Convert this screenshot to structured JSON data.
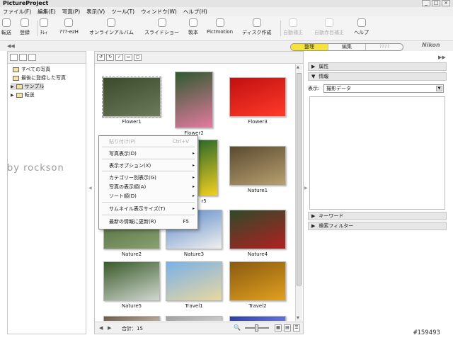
{
  "window": {
    "title": "PictureProject",
    "min_glyph": "_",
    "max_glyph": "□",
    "close_glyph": "×"
  },
  "menu": [
    "ファイル(F)",
    "編集(E)",
    "写真(P)",
    "表示(V)",
    "ツール(T)",
    "ウィンドウ(W)",
    "ヘルプ(H)"
  ],
  "toolbar": [
    {
      "label": "転送",
      "icon": "transfer-icon",
      "enabled": true
    },
    {
      "label": "登録",
      "icon": "register-icon",
      "enabled": true
    },
    {
      "label": "ﾁﾚｨ",
      "icon": "rotate-icon",
      "enabled": true
    },
    {
      "label": "???-ezH",
      "icon": "email-icon",
      "enabled": true
    },
    {
      "label": "オンラインアルバム",
      "icon": "online-album-icon",
      "enabled": true
    },
    {
      "label": "スライドショー",
      "icon": "slideshow-icon",
      "enabled": true
    },
    {
      "label": "製本",
      "icon": "book-icon",
      "enabled": true
    },
    {
      "label": "Pictmotion",
      "icon": "pictmotion-icon",
      "enabled": true
    },
    {
      "label": "ディスク作成",
      "icon": "disc-icon",
      "enabled": true
    },
    {
      "label": "自動補正",
      "icon": "auto-correct-icon",
      "enabled": false
    },
    {
      "label": "自動赤目補正",
      "icon": "red-eye-icon",
      "enabled": false
    },
    {
      "label": "ヘルプ",
      "icon": "help-icon",
      "enabled": true
    }
  ],
  "mode_tabs": [
    "整理",
    "編集",
    "????"
  ],
  "active_mode": "整理",
  "brand": "Nikon",
  "collapse_glyph": "◀◀",
  "expand_glyph": "▶▶",
  "left_tree": [
    {
      "label": "すべての写真",
      "selected": false,
      "arrow": ""
    },
    {
      "label": "最後に登録した写真",
      "selected": false,
      "arrow": ""
    },
    {
      "label": "サンプル",
      "selected": true,
      "arrow": "▶"
    },
    {
      "label": "転送",
      "selected": false,
      "arrow": "▶"
    }
  ],
  "thumbnails": [
    {
      "label": "Flower1",
      "colors": [
        "#3b4a2a",
        "#6b7a5a"
      ],
      "selected": true
    },
    {
      "label": "Flower2",
      "colors": [
        "#2f5a2f",
        "#e47aa0"
      ],
      "selected": false
    },
    {
      "label": "Flower3",
      "colors": [
        "#c01010",
        "#ff3a2a"
      ],
      "selected": false
    },
    {
      "label": "r5",
      "colors": [
        "#2f6a2a",
        "#f2d020"
      ],
      "selected": false
    },
    {
      "label": "Nature1",
      "colors": [
        "#5a4a30",
        "#b8a070"
      ],
      "selected": false
    },
    {
      "label": "Nature2",
      "colors": [
        "#4a6a3a",
        "#8aa070"
      ],
      "selected": false
    },
    {
      "label": "Nature3",
      "colors": [
        "#5a88c8",
        "#f0f0f0"
      ],
      "selected": false
    },
    {
      "label": "Nature4",
      "colors": [
        "#2f4a2a",
        "#b02020"
      ],
      "selected": false
    },
    {
      "label": "Nature5",
      "colors": [
        "#3a5a2a",
        "#d0d8d0"
      ],
      "selected": false
    },
    {
      "label": "Travel1",
      "colors": [
        "#7ab0e8",
        "#e8d8a0"
      ],
      "selected": false
    },
    {
      "label": "Travel2",
      "colors": [
        "#8a5a10",
        "#e0a020"
      ],
      "selected": false
    },
    {
      "label": "",
      "colors": [
        "#6a5a4a",
        "#c0b0a0"
      ],
      "selected": false
    },
    {
      "label": "",
      "colors": [
        "#a0a0a0",
        "#d0d0d0"
      ],
      "selected": false
    },
    {
      "label": "",
      "colors": [
        "#2a3aa0",
        "#6a7ae0"
      ],
      "selected": false
    }
  ],
  "context_menu": [
    {
      "label": "貼り付け(P)",
      "shortcut": "Ctrl+V",
      "submenu": false,
      "disabled": true
    },
    {
      "label": "写真表示(D)",
      "shortcut": "",
      "submenu": true,
      "disabled": false
    },
    {
      "label": "表示オプション(X)",
      "shortcut": "",
      "submenu": true,
      "disabled": false
    },
    {
      "label": "カテゴリー別表示(G)",
      "shortcut": "",
      "submenu": true,
      "disabled": false
    },
    {
      "label": "写真の表示順(A)",
      "shortcut": "",
      "submenu": true,
      "disabled": false
    },
    {
      "label": "ソート順(D)",
      "shortcut": "",
      "submenu": true,
      "disabled": false
    },
    {
      "label": "サムネイル表示サイズ(T)",
      "shortcut": "",
      "submenu": true,
      "disabled": false
    },
    {
      "label": "最新の情報に更新(R)",
      "shortcut": "F5",
      "submenu": false,
      "disabled": false
    }
  ],
  "submenu_glyph": "▸",
  "watermark": "by rockson",
  "status": {
    "count_label": "合計：15",
    "prev_glyph": "◀",
    "next_glyph": "▶",
    "zoom_glyph": "🔍"
  },
  "view_buttons": [
    "▦",
    "▤",
    "☰"
  ],
  "right_panel": {
    "sections": [
      {
        "label": "属性",
        "arrow": "▶"
      },
      {
        "label": "情報",
        "arrow": "▼"
      }
    ],
    "info_label": "表示:",
    "info_value": "撮影データ",
    "bottom_sections": [
      {
        "label": "キーワード",
        "arrow": "▶"
      },
      {
        "label": "検索フィルター",
        "arrow": "▶"
      }
    ]
  },
  "footer_tag": "#159493"
}
